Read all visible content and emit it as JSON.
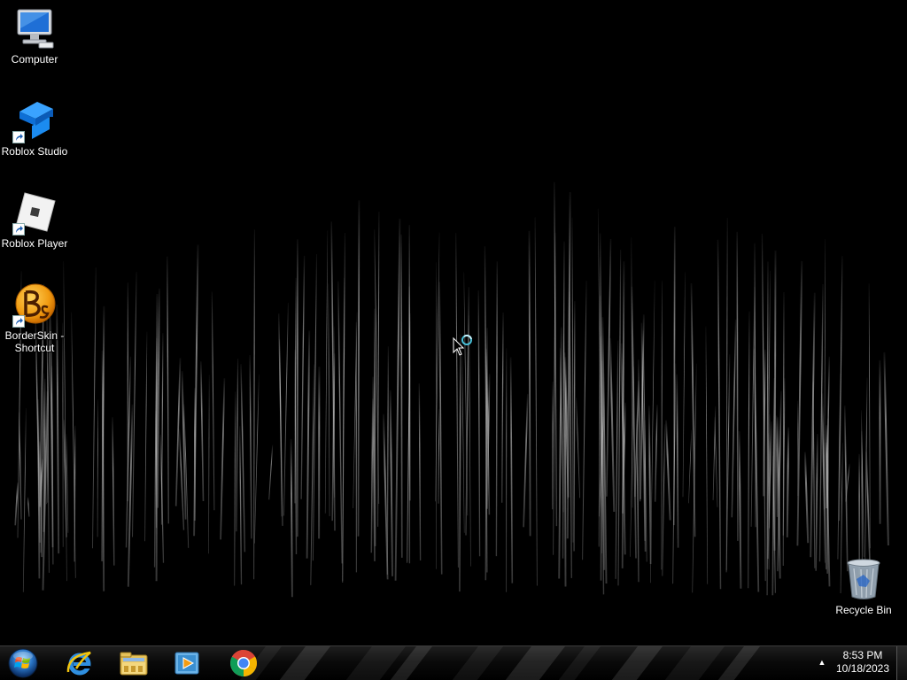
{
  "desktop": {
    "icons": [
      {
        "label": "Computer",
        "icon": "computer-icon"
      },
      {
        "label": "Roblox Studio",
        "icon": "roblox-studio-icon"
      },
      {
        "label": "Roblox Player",
        "icon": "roblox-player-icon"
      },
      {
        "label": "BorderSkin - Shortcut",
        "icon": "borderskin-icon"
      },
      {
        "label": "Recycle Bin",
        "icon": "recycle-bin-icon"
      }
    ]
  },
  "taskbar": {
    "start": {
      "icon": "windows-start-orb-icon"
    },
    "pinned": [
      {
        "icon": "internet-explorer-icon"
      },
      {
        "icon": "windows-explorer-icon"
      },
      {
        "icon": "windows-media-player-icon"
      },
      {
        "icon": "google-chrome-icon"
      }
    ],
    "tray": {
      "arrow_icon": "show-hidden-icons-icon",
      "arrow_glyph": "▲",
      "time": "8:53 PM",
      "date": "10/18/2023"
    }
  },
  "colors": {
    "background": "#000000",
    "accent": "#3a8fd8"
  }
}
